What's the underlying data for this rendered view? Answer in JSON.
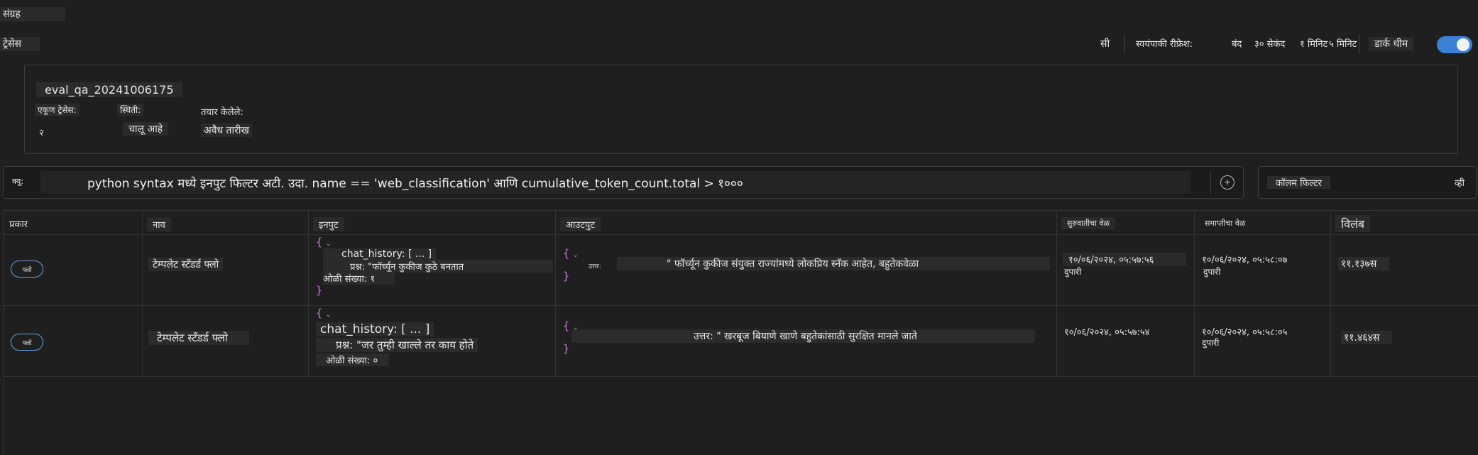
{
  "breadcrumb": {
    "collection": "संग्रह",
    "traces": "ट्रेसेस"
  },
  "toolbar": {
    "si": "सी",
    "auto_refresh_label": "स्वयंपाकी रीफ्रेश:",
    "refresh_options": [
      "बंद",
      "३० सेकंद",
      "१ मिनिट",
      "५ मिनिट"
    ],
    "dark_theme": "डार्क थीम",
    "dark_theme_on": true,
    "accent_color": "#3b82d6"
  },
  "summary": {
    "run_name": "eval_qa_20241006175",
    "trace_count_label": "एकूण ट्रेसेस:",
    "trace_count": "२",
    "status_label": "स्थिती:",
    "status": "चालू आहे",
    "created_label": "तयार केलेले:",
    "created": "अवैध तारीख"
  },
  "search": {
    "label": "क्यू:",
    "placeholder": "python syntax मध्ये इनपुट फिल्टर अटी. उदा. name == 'web_classification' आणि cumulative_token_count.total > १०००",
    "column_filter": "कॉलम फिल्टर",
    "column_filter_right": "व्ही"
  },
  "table": {
    "headers": [
      "प्रकार",
      "नाव",
      "इनपुट",
      "आउटपुट",
      "सुरुवातीचा वेळ",
      "समाप्तीचा वेळ",
      "विलंब"
    ],
    "rows": [
      {
        "type": "फ्लो",
        "name": "टेम्पलेट स्टॅंडर्ड फ्लो",
        "input_history": "chat_history: [ ... ]",
        "input_question": "प्रश्न: \"फॉर्च्यून कुकीज कुठे बनतात",
        "input_lines": "ओळी संख्या: १",
        "output_key": "उत्तर:",
        "output_text": "\" फॉर्च्यून कुकीज संयुक्त राज्यांमध्ये लोकप्रिय स्नॅक आहेत, बहुतेकवेळा",
        "start_time": "१०/०६/२०२४, ०५:५७:५६",
        "start_period": "दुपारी",
        "end_time": "१०/०६/२०२४, ०५:५८:०७",
        "end_period": "दुपारी",
        "latency": "११.१३७स"
      },
      {
        "type": "फ्लो",
        "name": "टेम्पलेट स्टॅंडर्ड फ्लो",
        "input_history": "chat_history: [ ... ]",
        "input_question": "प्रश्न: \"जर तुम्ही खाल्ले तर काय होते",
        "input_lines": "ओळी संख्या: ०",
        "output_key": "",
        "output_text": "उत्तर: \" खरबूज बियाणे खाणे बहुतेकांसाठी सुरक्षित मानले जाते",
        "start_time": "१०/०६/२०२४, ०५:५७:५४",
        "start_period": "",
        "end_time": "१०/०६/२०२४, ०५:५८:०५",
        "end_period": "दुपारी",
        "latency": "११.४६४स"
      }
    ]
  }
}
